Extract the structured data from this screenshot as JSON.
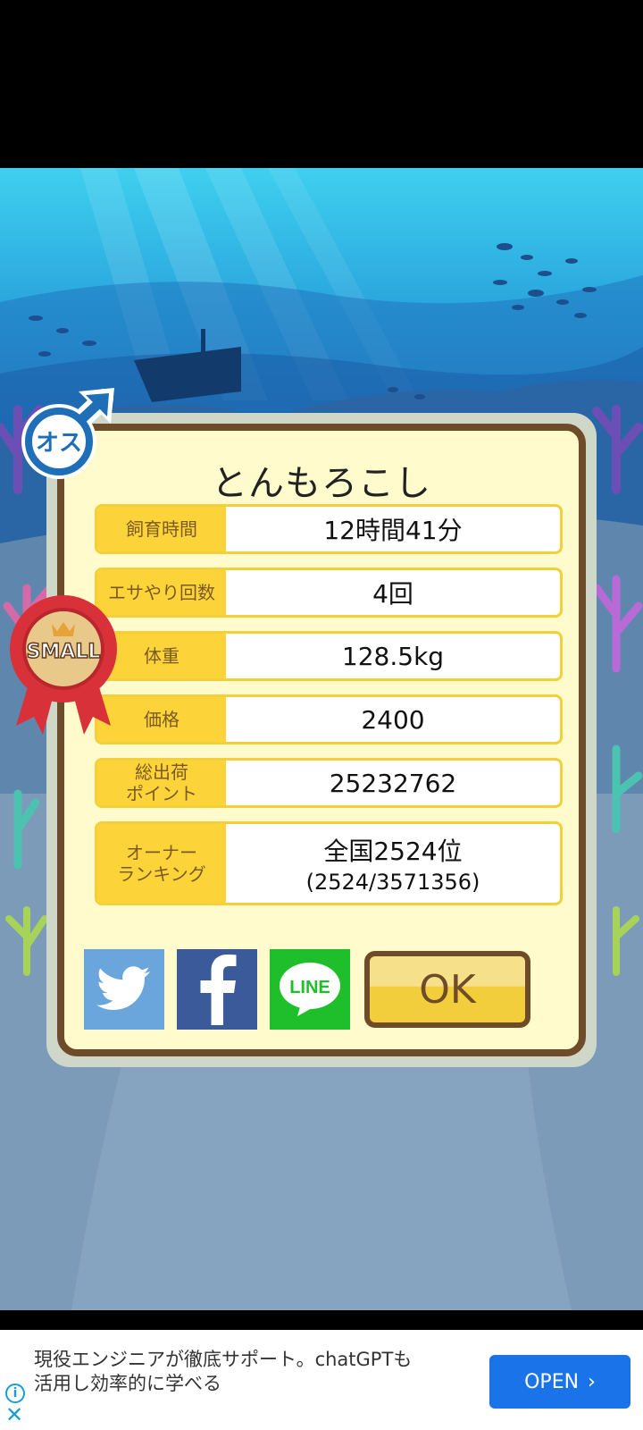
{
  "dialog": {
    "title": "とんもろこし",
    "rows": [
      {
        "label": "飼育時間",
        "value": "12時間41分"
      },
      {
        "label": "エサやり回数",
        "value": "4回"
      },
      {
        "label": "体重",
        "value": "128.5kg"
      },
      {
        "label": "価格",
        "value": "2400"
      },
      {
        "label": "総出荷\nポイント",
        "value": "25232762"
      },
      {
        "label": "オーナー\nランキング",
        "value": "全国2524位",
        "sub": "(2524/3571356)"
      }
    ],
    "ok_label": "OK",
    "share": {
      "line_label": "LINE"
    }
  },
  "badges": {
    "gender": "オス",
    "size": "SMALL"
  },
  "ad": {
    "line1": "現役エンジニアが徹底サポート。chatGPTも",
    "line2": "活用し効率的に学べる",
    "button_label": "OPEN"
  },
  "colors": {
    "panel_border": "#6e4c2a",
    "panel_bg": "#fffbcc",
    "label_bg": "#fdd33a",
    "ad_button": "#1a73e8"
  }
}
